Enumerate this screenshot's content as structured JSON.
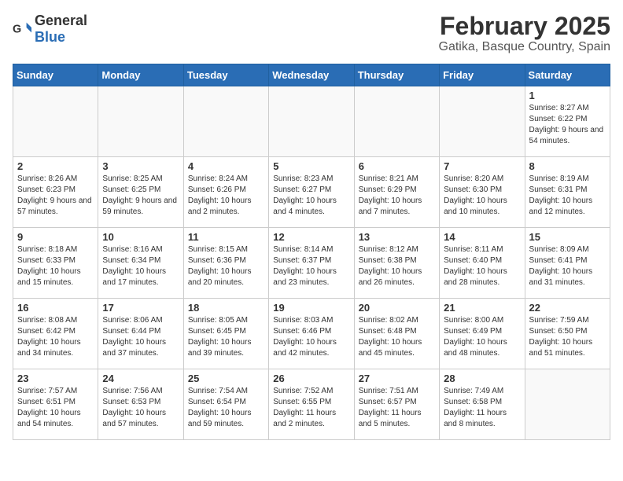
{
  "header": {
    "logo_general": "General",
    "logo_blue": "Blue",
    "title": "February 2025",
    "subtitle": "Gatika, Basque Country, Spain"
  },
  "weekdays": [
    "Sunday",
    "Monday",
    "Tuesday",
    "Wednesday",
    "Thursday",
    "Friday",
    "Saturday"
  ],
  "weeks": [
    [
      {
        "day": "",
        "info": ""
      },
      {
        "day": "",
        "info": ""
      },
      {
        "day": "",
        "info": ""
      },
      {
        "day": "",
        "info": ""
      },
      {
        "day": "",
        "info": ""
      },
      {
        "day": "",
        "info": ""
      },
      {
        "day": "1",
        "info": "Sunrise: 8:27 AM\nSunset: 6:22 PM\nDaylight: 9 hours and 54 minutes."
      }
    ],
    [
      {
        "day": "2",
        "info": "Sunrise: 8:26 AM\nSunset: 6:23 PM\nDaylight: 9 hours and 57 minutes."
      },
      {
        "day": "3",
        "info": "Sunrise: 8:25 AM\nSunset: 6:25 PM\nDaylight: 9 hours and 59 minutes."
      },
      {
        "day": "4",
        "info": "Sunrise: 8:24 AM\nSunset: 6:26 PM\nDaylight: 10 hours and 2 minutes."
      },
      {
        "day": "5",
        "info": "Sunrise: 8:23 AM\nSunset: 6:27 PM\nDaylight: 10 hours and 4 minutes."
      },
      {
        "day": "6",
        "info": "Sunrise: 8:21 AM\nSunset: 6:29 PM\nDaylight: 10 hours and 7 minutes."
      },
      {
        "day": "7",
        "info": "Sunrise: 8:20 AM\nSunset: 6:30 PM\nDaylight: 10 hours and 10 minutes."
      },
      {
        "day": "8",
        "info": "Sunrise: 8:19 AM\nSunset: 6:31 PM\nDaylight: 10 hours and 12 minutes."
      }
    ],
    [
      {
        "day": "9",
        "info": "Sunrise: 8:18 AM\nSunset: 6:33 PM\nDaylight: 10 hours and 15 minutes."
      },
      {
        "day": "10",
        "info": "Sunrise: 8:16 AM\nSunset: 6:34 PM\nDaylight: 10 hours and 17 minutes."
      },
      {
        "day": "11",
        "info": "Sunrise: 8:15 AM\nSunset: 6:36 PM\nDaylight: 10 hours and 20 minutes."
      },
      {
        "day": "12",
        "info": "Sunrise: 8:14 AM\nSunset: 6:37 PM\nDaylight: 10 hours and 23 minutes."
      },
      {
        "day": "13",
        "info": "Sunrise: 8:12 AM\nSunset: 6:38 PM\nDaylight: 10 hours and 26 minutes."
      },
      {
        "day": "14",
        "info": "Sunrise: 8:11 AM\nSunset: 6:40 PM\nDaylight: 10 hours and 28 minutes."
      },
      {
        "day": "15",
        "info": "Sunrise: 8:09 AM\nSunset: 6:41 PM\nDaylight: 10 hours and 31 minutes."
      }
    ],
    [
      {
        "day": "16",
        "info": "Sunrise: 8:08 AM\nSunset: 6:42 PM\nDaylight: 10 hours and 34 minutes."
      },
      {
        "day": "17",
        "info": "Sunrise: 8:06 AM\nSunset: 6:44 PM\nDaylight: 10 hours and 37 minutes."
      },
      {
        "day": "18",
        "info": "Sunrise: 8:05 AM\nSunset: 6:45 PM\nDaylight: 10 hours and 39 minutes."
      },
      {
        "day": "19",
        "info": "Sunrise: 8:03 AM\nSunset: 6:46 PM\nDaylight: 10 hours and 42 minutes."
      },
      {
        "day": "20",
        "info": "Sunrise: 8:02 AM\nSunset: 6:48 PM\nDaylight: 10 hours and 45 minutes."
      },
      {
        "day": "21",
        "info": "Sunrise: 8:00 AM\nSunset: 6:49 PM\nDaylight: 10 hours and 48 minutes."
      },
      {
        "day": "22",
        "info": "Sunrise: 7:59 AM\nSunset: 6:50 PM\nDaylight: 10 hours and 51 minutes."
      }
    ],
    [
      {
        "day": "23",
        "info": "Sunrise: 7:57 AM\nSunset: 6:51 PM\nDaylight: 10 hours and 54 minutes."
      },
      {
        "day": "24",
        "info": "Sunrise: 7:56 AM\nSunset: 6:53 PM\nDaylight: 10 hours and 57 minutes."
      },
      {
        "day": "25",
        "info": "Sunrise: 7:54 AM\nSunset: 6:54 PM\nDaylight: 10 hours and 59 minutes."
      },
      {
        "day": "26",
        "info": "Sunrise: 7:52 AM\nSunset: 6:55 PM\nDaylight: 11 hours and 2 minutes."
      },
      {
        "day": "27",
        "info": "Sunrise: 7:51 AM\nSunset: 6:57 PM\nDaylight: 11 hours and 5 minutes."
      },
      {
        "day": "28",
        "info": "Sunrise: 7:49 AM\nSunset: 6:58 PM\nDaylight: 11 hours and 8 minutes."
      },
      {
        "day": "",
        "info": ""
      }
    ]
  ]
}
